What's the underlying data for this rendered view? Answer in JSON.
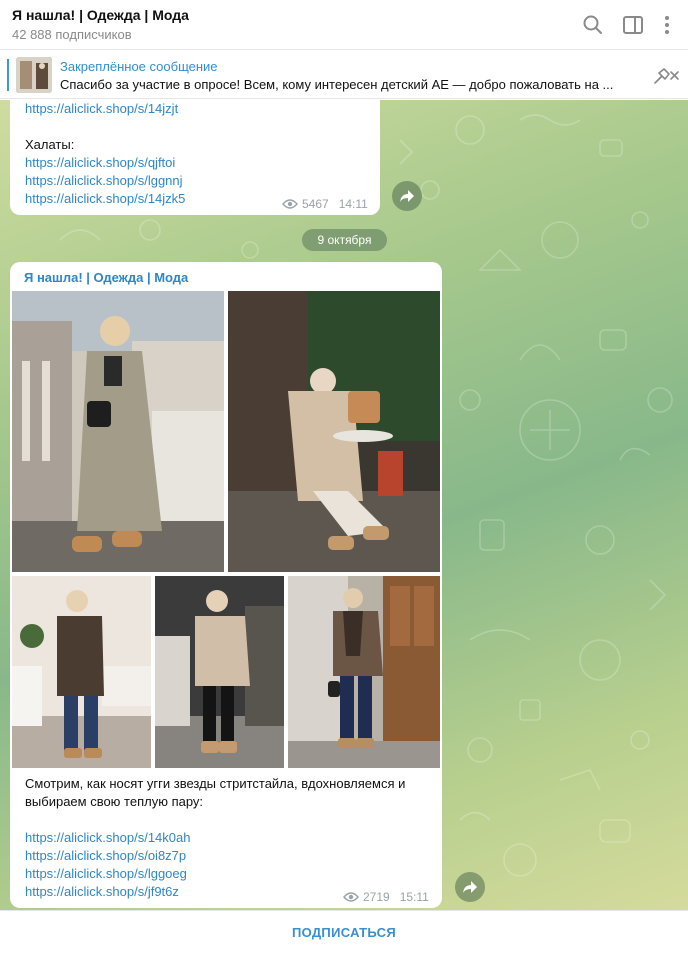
{
  "header": {
    "title": "Я нашла! | Одежда | Мода",
    "subscribers": "42 888 подписчиков"
  },
  "pinned": {
    "title": "Закреплённое сообщение",
    "text": "Спасибо за участие в опросе!   Всем, кому интересен детский АЕ — добро пожаловать на ..."
  },
  "message1": {
    "link_top": "https://aliclick.shop/s/14jzjt",
    "section_label": "Халаты:",
    "links": [
      "https://aliclick.shop/s/qjftoi",
      "https://aliclick.shop/s/lggnnj",
      "https://aliclick.shop/s/14jzk5"
    ],
    "views": "5467",
    "time": "14:11"
  },
  "date_separator": "9 октября",
  "message2": {
    "author": "Я нашла! | Одежда | Мода",
    "text": "Смотрим, как носят угги звезды стритстайла, вдохновляемся и выбираем свою теплую пару:",
    "links": [
      "https://aliclick.shop/s/14k0ah",
      "https://aliclick.shop/s/oi8z7p",
      "https://aliclick.shop/s/lggoeg",
      "https://aliclick.shop/s/jf9t6z"
    ],
    "views": "2719",
    "time": "15:11"
  },
  "footer": {
    "subscribe_label": "ПОДПИСАТЬСЯ"
  },
  "colors": {
    "accent": "#2f86c8",
    "chat_bg": "#a6c88c"
  }
}
